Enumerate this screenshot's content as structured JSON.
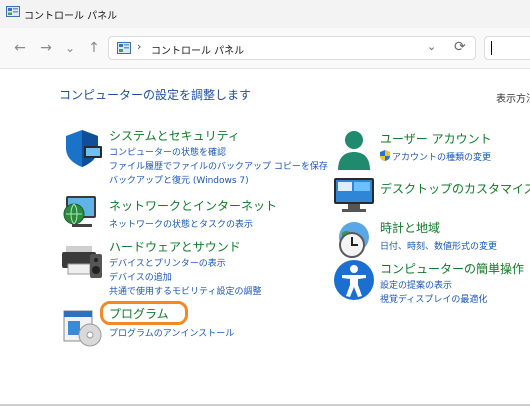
{
  "window": {
    "title": "コントロール パネル",
    "icon": "control-panel-icon"
  },
  "nav": {
    "back": "←",
    "forward": "→",
    "recent": "⌄",
    "up": "↑",
    "address": {
      "separator": "›",
      "path": "コントロール パネル",
      "trailing_separator": "›",
      "dropdown": "⌄",
      "refresh": "⟳"
    },
    "search": {
      "value": ""
    }
  },
  "main": {
    "title": "コンピューターの設定を調整します",
    "view_by": "表示方法",
    "categories_left": [
      {
        "icon": "security-shield-icon",
        "heading": "システムとセキュリティ",
        "links": [
          "コンピューターの状態を確認",
          "ファイル履歴でファイルのバックアップ コピーを保存",
          "バックアップと復元 (Windows 7)"
        ]
      },
      {
        "icon": "network-globe-icon",
        "heading": "ネットワークとインターネット",
        "links": [
          "ネットワークの状態とタスクの表示"
        ]
      },
      {
        "icon": "printer-speaker-icon",
        "heading": "ハードウェアとサウンド",
        "links": [
          "デバイスとプリンターの表示",
          "デバイスの追加",
          "共通で使用するモビリティ設定の調整"
        ]
      },
      {
        "icon": "program-disc-icon",
        "heading": "プログラム",
        "links": [
          "プログラムのアンインストール"
        ]
      }
    ],
    "categories_right": [
      {
        "icon": "user-account-icon",
        "heading": "ユーザー アカウント",
        "links": [
          "アカウントの種類の変更"
        ]
      },
      {
        "icon": "desktop-customize-icon",
        "heading": "デスクトップのカスタマイズ",
        "links": []
      },
      {
        "icon": "clock-globe-icon",
        "heading": "時計と地域",
        "links": [
          "日付、時刻、数値形式の変更"
        ]
      },
      {
        "icon": "accessibility-icon",
        "heading": "コンピューターの簡単操作",
        "links": [
          "設定の提案の表示",
          "視覚ディスプレイの最適化"
        ]
      }
    ],
    "highlight_color": "#f08a24"
  },
  "colors": {
    "heading_green": "#0f7a28",
    "link_blue": "#1a57b8",
    "title_blue": "#1f4e9e"
  }
}
